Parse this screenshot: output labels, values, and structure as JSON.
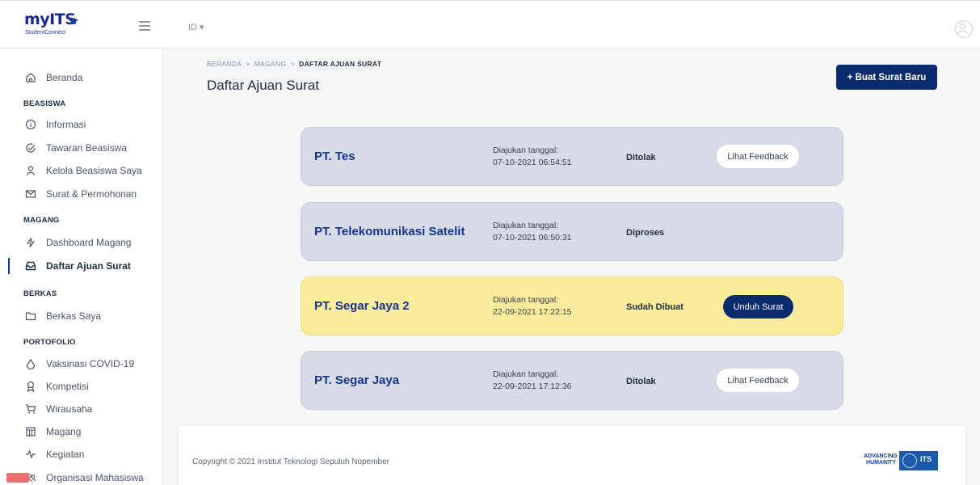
{
  "header": {
    "logo_text": "myITS",
    "logo_sub": "StudentConnect",
    "lang": "ID ▾"
  },
  "sidebar": {
    "home": "Beranda",
    "sections": {
      "beasiswa": "BEASISWA",
      "magang": "MAGANG",
      "berkas": "BERKAS",
      "portofolio": "PORTOFOLIO"
    },
    "items": {
      "informasi": "Informasi",
      "tawaran": "Tawaran Beasiswa",
      "kelola": "Kelola Beasiswa Saya",
      "surat": "Surat & Permohonan",
      "dashboard_magang": "Dashboard Magang",
      "daftar_ajuan": "Daftar Ajuan Surat",
      "berkas_saya": "Berkas Saya",
      "vaksinasi": "Vaksinasi COVID-19",
      "kompetisi": "Kompetisi",
      "wirausaha": "Wirausaha",
      "magang": "Magang",
      "kegiatan": "Kegiatan",
      "organisasi": "Organisasi Mahasiswa"
    }
  },
  "main": {
    "breadcrumb": {
      "home": "BERANDA",
      "sep": ">",
      "parent": "MAGANG",
      "current": "DAFTAR AJUAN SURAT"
    },
    "title": "Daftar Ajuan Surat",
    "new_button": "+ Buat Surat Baru",
    "cards": [
      {
        "company": "PT. Tes",
        "date_label": "Diajukan tanggal:",
        "date": "07-10-2021 06:54:51",
        "status": "Ditolak",
        "action": "Lihat Feedback"
      },
      {
        "company": "PT. Telekomunikasi Satelit",
        "date_label": "Diajukan tanggal:",
        "date": "07-10-2021 06:50:31",
        "status": "Diproses",
        "action": ""
      },
      {
        "company": "PT. Segar Jaya 2",
        "date_label": "Diajukan tanggal:",
        "date": "22-09-2021 17:22:15",
        "status": "Sudah Dibuat",
        "action": "Unduh Surat"
      },
      {
        "company": "PT. Segar Jaya",
        "date_label": "Diajukan tanggal:",
        "date": "22-09-2021 17:12:36",
        "status": "Ditolak",
        "action": "Lihat Feedback"
      }
    ]
  },
  "footer": {
    "copyright": "Copyright © 2021 Institut Teknologi Sepuluh Nopember",
    "badge_line1": "ADVANCING",
    "badge_line2": "HUMANITY",
    "badge_its": "ITS"
  },
  "colors": {
    "primary": "#0b2c6c",
    "card_default": "#d6dbe6",
    "card_highlight": "#fbec9c",
    "company_text": "#17348d"
  }
}
